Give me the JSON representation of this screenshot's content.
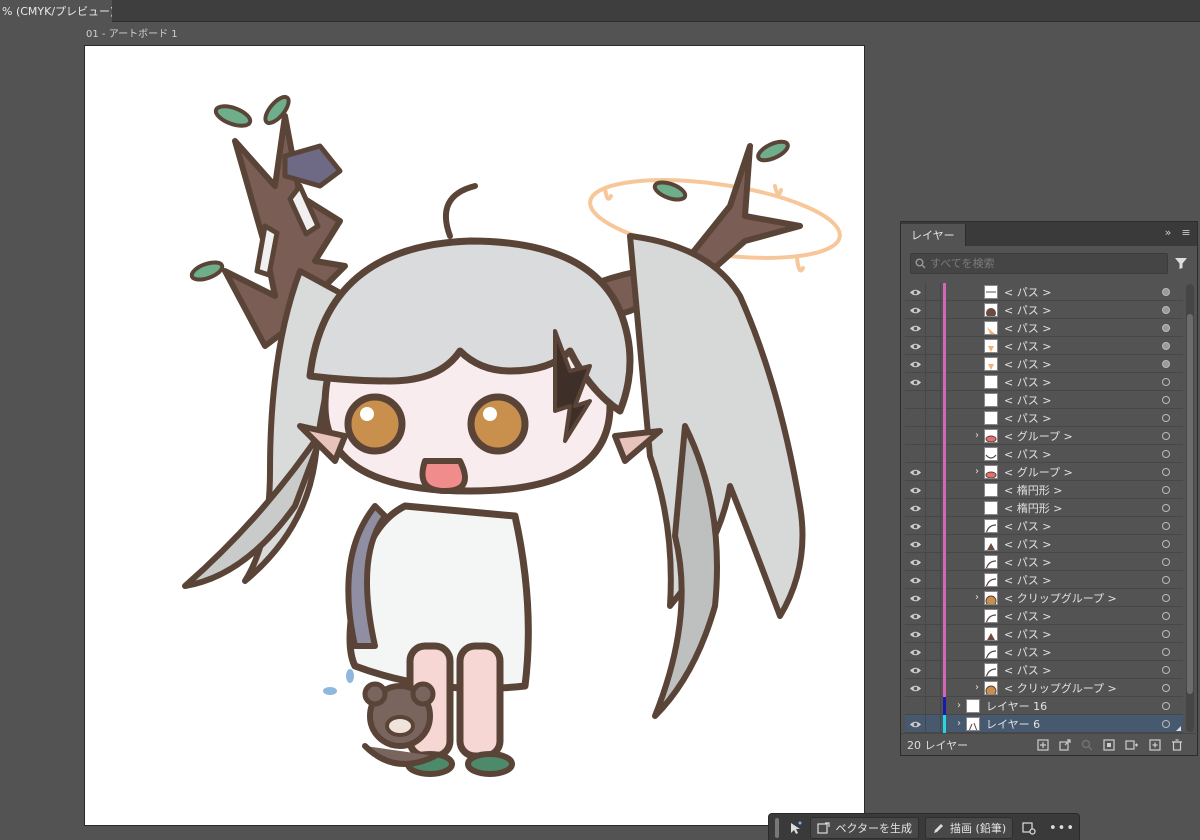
{
  "document": {
    "tab_title": "% (CMYK/プレビュー)",
    "close": "×"
  },
  "artboard": {
    "label": "01 - アートボード 1"
  },
  "layers_panel": {
    "tab": "レイヤー",
    "search_placeholder": "すべてを検索",
    "count_label": "20 レイヤー",
    "rows": [
      {
        "name": "< パス >",
        "visible": true,
        "expand": false,
        "level": 2,
        "target": "filled",
        "bar": "#d267b7",
        "thumb": "line"
      },
      {
        "name": "< パス >",
        "visible": true,
        "expand": false,
        "level": 2,
        "target": "filled",
        "bar": "#d267b7",
        "thumb": "brown-dot"
      },
      {
        "name": "< パス >",
        "visible": true,
        "expand": false,
        "level": 2,
        "target": "filled",
        "bar": "#d267b7",
        "thumb": "orange"
      },
      {
        "name": "< パス >",
        "visible": true,
        "expand": false,
        "level": 2,
        "target": "filled",
        "bar": "#d267b7",
        "thumb": "orange-small"
      },
      {
        "name": "< パス >",
        "visible": true,
        "expand": false,
        "level": 2,
        "target": "filled",
        "bar": "#d267b7",
        "thumb": "orange-small"
      },
      {
        "name": "< パス >",
        "visible": true,
        "expand": false,
        "level": 2,
        "target": "empty",
        "bar": "#d267b7",
        "thumb": "blank"
      },
      {
        "name": "< パス >",
        "visible": false,
        "expand": false,
        "level": 2,
        "target": "empty",
        "bar": "#d267b7",
        "thumb": "blank"
      },
      {
        "name": "< パス >",
        "visible": false,
        "expand": false,
        "level": 2,
        "target": "empty",
        "bar": "#d267b7",
        "thumb": "blank"
      },
      {
        "name": "< グループ >",
        "visible": false,
        "expand": true,
        "level": 2,
        "target": "empty",
        "bar": "#d267b7",
        "thumb": "mouth"
      },
      {
        "name": "< パス >",
        "visible": false,
        "expand": false,
        "level": 2,
        "target": "empty",
        "bar": "#d267b7",
        "thumb": "curve"
      },
      {
        "name": "< グループ >",
        "visible": true,
        "expand": true,
        "level": 2,
        "target": "empty",
        "bar": "#d267b7",
        "thumb": "mouth"
      },
      {
        "name": "< 楕円形 >",
        "visible": true,
        "expand": false,
        "level": 2,
        "target": "empty",
        "bar": "#d267b7",
        "thumb": "blank"
      },
      {
        "name": "< 楕円形 >",
        "visible": true,
        "expand": false,
        "level": 2,
        "target": "empty",
        "bar": "#d267b7",
        "thumb": "blank"
      },
      {
        "name": "< パス >",
        "visible": true,
        "expand": false,
        "level": 2,
        "target": "empty",
        "bar": "#d267b7",
        "thumb": "arc"
      },
      {
        "name": "< パス >",
        "visible": true,
        "expand": false,
        "level": 2,
        "target": "empty",
        "bar": "#d267b7",
        "thumb": "brown-shape"
      },
      {
        "name": "< パス >",
        "visible": true,
        "expand": false,
        "level": 2,
        "target": "empty",
        "bar": "#d267b7",
        "thumb": "arc"
      },
      {
        "name": "< パス >",
        "visible": true,
        "expand": false,
        "level": 2,
        "target": "empty",
        "bar": "#d267b7",
        "thumb": "arc"
      },
      {
        "name": "< クリップグループ >",
        "visible": true,
        "expand": true,
        "level": 2,
        "target": "empty",
        "bar": "#d267b7",
        "thumb": "eye"
      },
      {
        "name": "< パス >",
        "visible": true,
        "expand": false,
        "level": 2,
        "target": "empty",
        "bar": "#d267b7",
        "thumb": "arc"
      },
      {
        "name": "< パス >",
        "visible": true,
        "expand": false,
        "level": 2,
        "target": "empty",
        "bar": "#d267b7",
        "thumb": "brown-shape"
      },
      {
        "name": "< パス >",
        "visible": true,
        "expand": false,
        "level": 2,
        "target": "empty",
        "bar": "#d267b7",
        "thumb": "arc"
      },
      {
        "name": "< パス >",
        "visible": true,
        "expand": false,
        "level": 2,
        "target": "empty",
        "bar": "#d267b7",
        "thumb": "arc"
      },
      {
        "name": "< クリップグループ >",
        "visible": true,
        "expand": true,
        "level": 2,
        "target": "empty",
        "bar": "#d267b7",
        "thumb": "eye"
      },
      {
        "name": "レイヤー 16",
        "visible": false,
        "expand": true,
        "level": 0,
        "target": "empty",
        "bar": "#1a1ab0",
        "thumb": "blank"
      },
      {
        "name": "レイヤー 6",
        "visible": true,
        "expand": true,
        "level": 0,
        "target": "empty",
        "bar": "#27d7e0",
        "thumb": "figure",
        "selected": true
      }
    ]
  },
  "taskbar": {
    "generate_vector_label": "ベクターを生成",
    "draw_label": "描画 (鉛筆)",
    "more": "•••"
  }
}
